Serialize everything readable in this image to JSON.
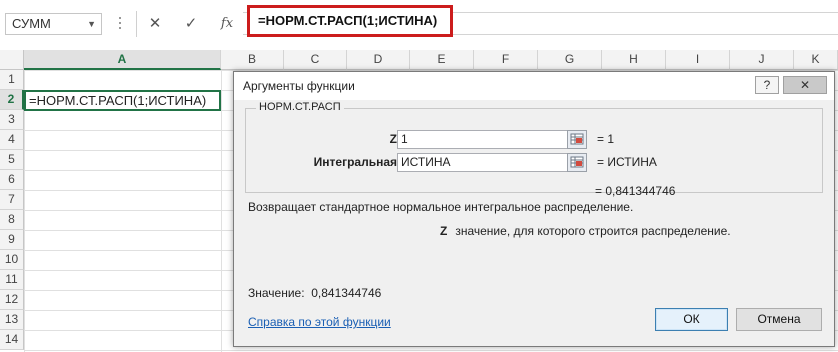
{
  "formula_bar": {
    "name_box": "СУММ",
    "cancel_glyph": "✕",
    "enter_glyph": "✓",
    "fx_label": "fx",
    "formula": "=НОРМ.СТ.РАСП(1;ИСТИНА)"
  },
  "sheet": {
    "columns": [
      "A",
      "B",
      "C",
      "D",
      "E",
      "F",
      "G",
      "H",
      "I",
      "J",
      "K"
    ],
    "rows": [
      "1",
      "2",
      "3",
      "4",
      "5",
      "6",
      "7",
      "8",
      "9",
      "10",
      "11",
      "12",
      "13",
      "14"
    ],
    "active_column": "A",
    "active_row": "2",
    "active_cell_content": "=НОРМ.СТ.РАСП(1;ИСТИНА)"
  },
  "dialog": {
    "title": "Аргументы функции",
    "help_glyph": "?",
    "close_glyph": "✕",
    "function_name": "НОРМ.СТ.РАСП",
    "args": [
      {
        "label": "Z",
        "value": "1",
        "result": "=  1"
      },
      {
        "label": "Интегральная",
        "value": "ИСТИНА",
        "result": "=  ИСТИНА"
      }
    ],
    "formula_result": "=  0,841344746",
    "description": "Возвращает стандартное нормальное интегральное распределение.",
    "arg_help_name": "Z",
    "arg_help_text": "значение, для которого строится распределение.",
    "value_label": "Значение:",
    "value": "0,841344746",
    "help_link": "Справка по этой функции",
    "ok_label": "ОК",
    "cancel_label": "Отмена"
  },
  "colors": {
    "accent_green": "#217346",
    "highlight_red": "#cc1c1c",
    "link_blue": "#1a5fb4"
  }
}
